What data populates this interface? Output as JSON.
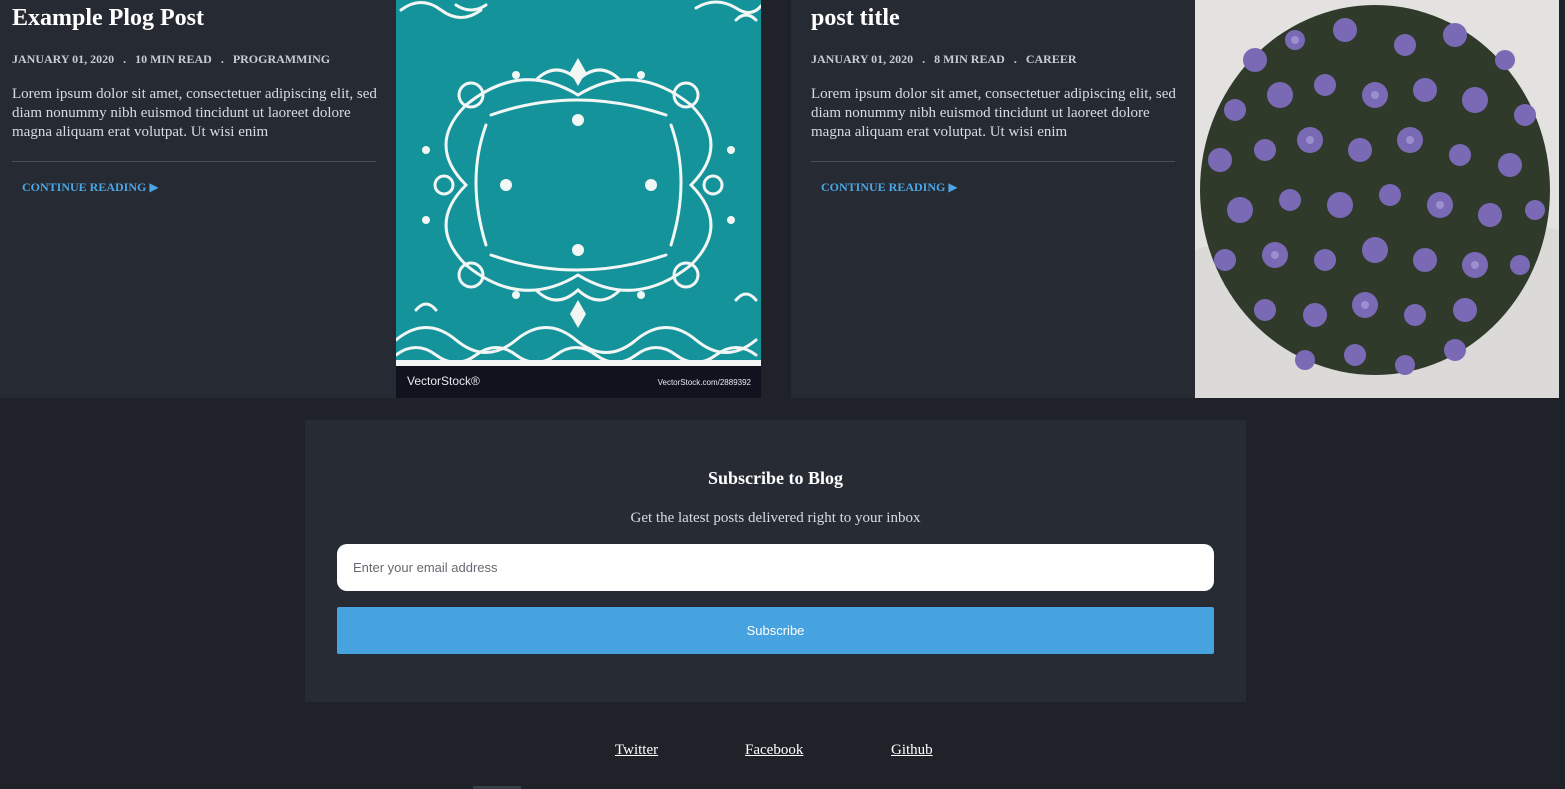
{
  "posts": [
    {
      "title": "Example Plog Post",
      "date": "January 01, 2020",
      "read_time": "10 min read",
      "category": "Programming",
      "separator": ".",
      "excerpt": "Lorem ipsum dolor sit amet, consectetuer adipiscing elit, sed diam nonummy nibh euismod tincidunt ut laoreet dolore magna aliquam erat volutpat. Ut wisi enim",
      "continue_label": "Continue reading ▶",
      "image": {
        "description": "teal ornamental frame illustration",
        "watermark_logo": "VectorStock®",
        "watermark_url": "VectorStock.com/2889392"
      }
    },
    {
      "title": "post title",
      "date": "January 01, 2020",
      "read_time": "8 min read",
      "category": "Career",
      "separator": ".",
      "excerpt": "Lorem ipsum dolor sit amet, consectetuer adipiscing elit, sed diam nonummy nibh euismod tincidunt ut laoreet dolore magna aliquam erat volutpat. Ut wisi enim",
      "continue_label": "Continue reading ▶",
      "image": {
        "description": "purple flowers hanging basket photo"
      }
    }
  ],
  "subscribe": {
    "title": "Subscribe to Blog",
    "description": "Get the latest posts delivered right to your inbox",
    "email_placeholder": "Enter your email address",
    "email_value": "",
    "button_label": "Subscribe"
  },
  "footer": {
    "links": [
      "Twitter",
      "Facebook",
      "Github"
    ]
  },
  "colors": {
    "page_bg": "#1f2229",
    "card_bg": "#262a33",
    "accent": "#4aa6e4",
    "button": "#46a3e0",
    "teal": "#14939b",
    "flower": "#7b6bb8"
  }
}
